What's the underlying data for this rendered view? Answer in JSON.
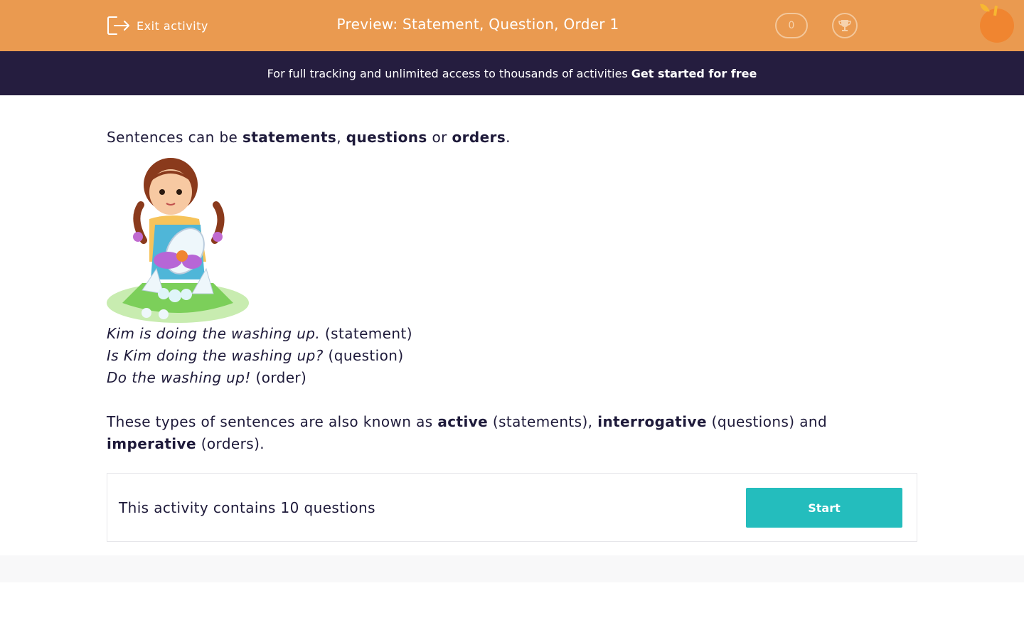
{
  "header": {
    "exit_label": "Exit activity",
    "title": "Preview: Statement, Question, Order 1",
    "score": "0",
    "colors": {
      "bar": "#ea9a50",
      "banner": "#251d3f",
      "accent": "#24bdbd"
    }
  },
  "banner": {
    "text": "For full tracking and unlimited access to thousands of activities",
    "cta": "Get started for free"
  },
  "intro": {
    "part1": "Sentences can be ",
    "statements": "statements",
    "comma": ", ",
    "questions": "questions",
    "or": " or ",
    "orders": "orders",
    "period": "."
  },
  "examples": [
    {
      "sentence": "Kim is doing the washing up.",
      "type": " (statement)"
    },
    {
      "sentence": "Is Kim doing the washing up?",
      "type": " (question)"
    },
    {
      "sentence": "Do the washing up!",
      "type": " (order)"
    }
  ],
  "paragraph": {
    "p1": "These types of sentences are also known as ",
    "active": "active",
    "p2": " (statements), ",
    "interrogative": "interrogative",
    "p3": " (questions) and ",
    "imperative": "imperative",
    "p4": " (orders)."
  },
  "activity": {
    "count_text": "This activity contains 10 questions",
    "start_label": "Start"
  }
}
